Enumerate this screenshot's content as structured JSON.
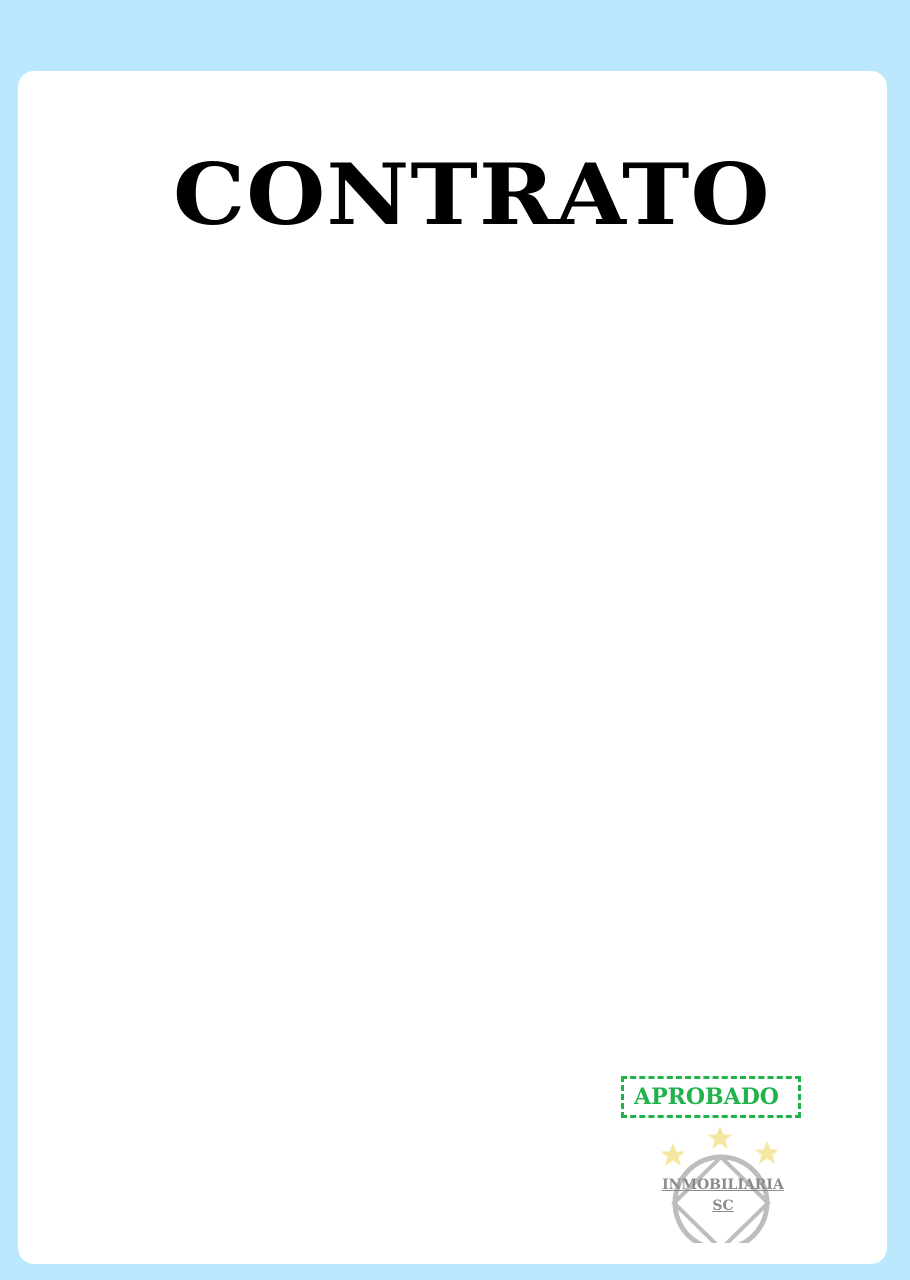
{
  "document": {
    "title": "CONTRATO"
  },
  "stamp": {
    "label": "APROBADO",
    "color": "#20b24b"
  },
  "seal": {
    "line1": "INMOBILIARIA",
    "line2": "SC",
    "icons": [
      "star-icon",
      "star-icon",
      "star-icon"
    ]
  },
  "colors": {
    "background": "#bbe8fd",
    "sheet": "#ffffff",
    "title": "#000000",
    "seal": "#bdbdbd",
    "stars": "#f6e7a0"
  }
}
